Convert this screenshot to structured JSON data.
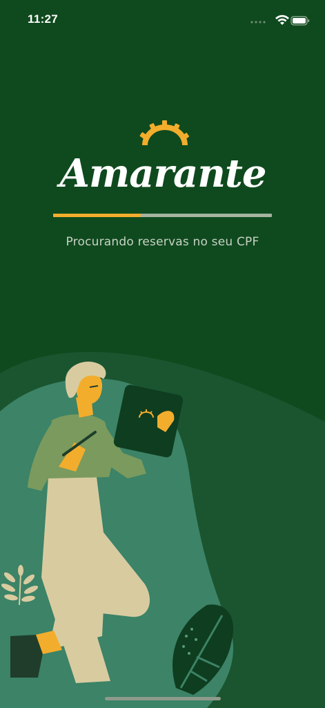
{
  "status_bar": {
    "time": "11:27",
    "icons": [
      "signal-dots-icon",
      "wifi-icon",
      "battery-icon"
    ]
  },
  "brand": {
    "name": "Amarante",
    "logo_icon": "sun-icon",
    "primary_color": "#0f4a1e",
    "accent_color": "#f3ad2c"
  },
  "loading": {
    "progress": 0.4,
    "message": "Procurando reservas no seu CPF"
  },
  "illustration": {
    "subject": "person-holding-tablet-illustration",
    "plants": [
      "fern-leaf-icon",
      "monstera-leaf-icon"
    ]
  }
}
